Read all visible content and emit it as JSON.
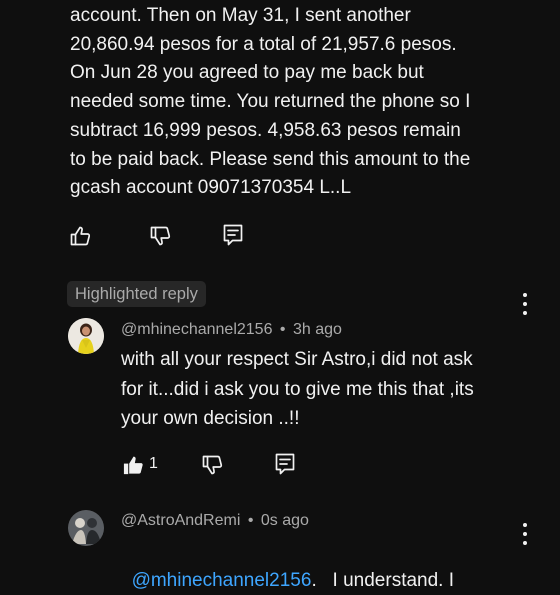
{
  "parent_comment": {
    "lines": [
      "account. Then on May 31, I sent another",
      "20,860.94 pesos for a total of 21,957.6 pesos.",
      "On Jun 28 you agreed to pay me back but",
      "needed some time. You returned the phone so I",
      "subtract 16,999 pesos. 4,958.63 pesos remain",
      "to be paid back. Please send this amount to the",
      "gcash account 09071370354 L..L"
    ]
  },
  "highlighted_label": "Highlighted reply",
  "highlighted_reply": {
    "author": "@mhinechannel2156",
    "separator": "•",
    "time": "3h ago",
    "lines": [
      "with all your respect Sir Astro,i did not ask",
      "for it...did i ask you to give me this that ,its",
      "your own decision ..!!"
    ],
    "like_count": "1"
  },
  "next_reply": {
    "author": "@AstroAndRemi",
    "separator": "•",
    "time": "0s ago",
    "mention": "@mhinechannel2156",
    "text_after_mention": ".   I understand. I"
  },
  "colors": {
    "background": "#0f0f0f",
    "text": "#f1f1f1",
    "secondary": "#aaaaaa",
    "mention": "#3ea6ff",
    "badge_bg": "#272727"
  }
}
